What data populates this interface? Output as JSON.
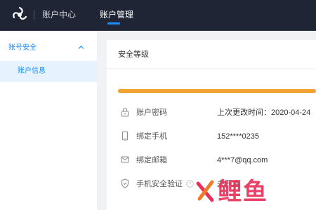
{
  "header": {
    "app_title": "账户中心",
    "nav_tab": "账户管理",
    "accent_color": "#1890ff",
    "bar_color": "#1f2534"
  },
  "sidebar": {
    "group_label": "账号安全",
    "group_expanded": true,
    "items": [
      {
        "label": "账户信息",
        "selected": true
      }
    ]
  },
  "security": {
    "title": "安全等级",
    "level_fraction": 1.0,
    "level_color": "#f0a534",
    "rows": [
      {
        "icon": "lock-icon",
        "label": "账户密码",
        "value": "上次更改时间：2020-04-24"
      },
      {
        "icon": "phone-icon",
        "label": "绑定手机",
        "value": "152****0235"
      },
      {
        "icon": "mail-icon",
        "label": "绑定邮箱",
        "value": "4***7@qq.com"
      },
      {
        "icon": "shield-icon",
        "label": "手机安全验证",
        "value": "未开启",
        "help_icon": "question-icon"
      }
    ]
  },
  "watermark": {
    "text": "鲤鱼",
    "logo_icon": "x-logo-icon",
    "color": "#e83058"
  }
}
